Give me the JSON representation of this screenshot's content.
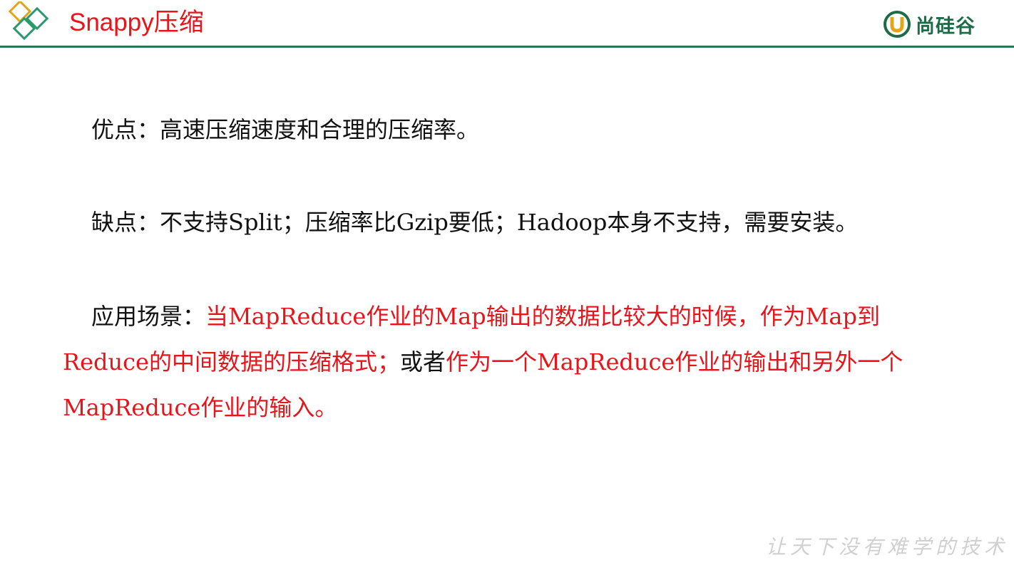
{
  "header": {
    "title": "Snappy压缩",
    "brand_name": "尚硅谷",
    "accent_color": "#e8141a",
    "brand_color": "#1e6b47",
    "logo_icon": "diamond-logo-icon",
    "brand_icon": "shangguigu-logo-icon"
  },
  "content": {
    "pros_label": "优点：",
    "pros_text": "高速压缩速度和合理的压缩率。",
    "cons_label": "缺点：",
    "cons_text": "不支持Split；压缩率比Gzip要低；Hadoop本身不支持，需要安装。",
    "usage_label": "应用场景：",
    "usage_text_1": "当MapReduce作业的Map输出的数据比较大的时候，作为Map到Reduce的中间数据的压缩格式；",
    "usage_or": "或者",
    "usage_text_2": "作为一个MapReduce作业的输出和另外一个MapReduce作业的输入。"
  },
  "footer": {
    "slogan": "让天下没有难学的技术"
  }
}
